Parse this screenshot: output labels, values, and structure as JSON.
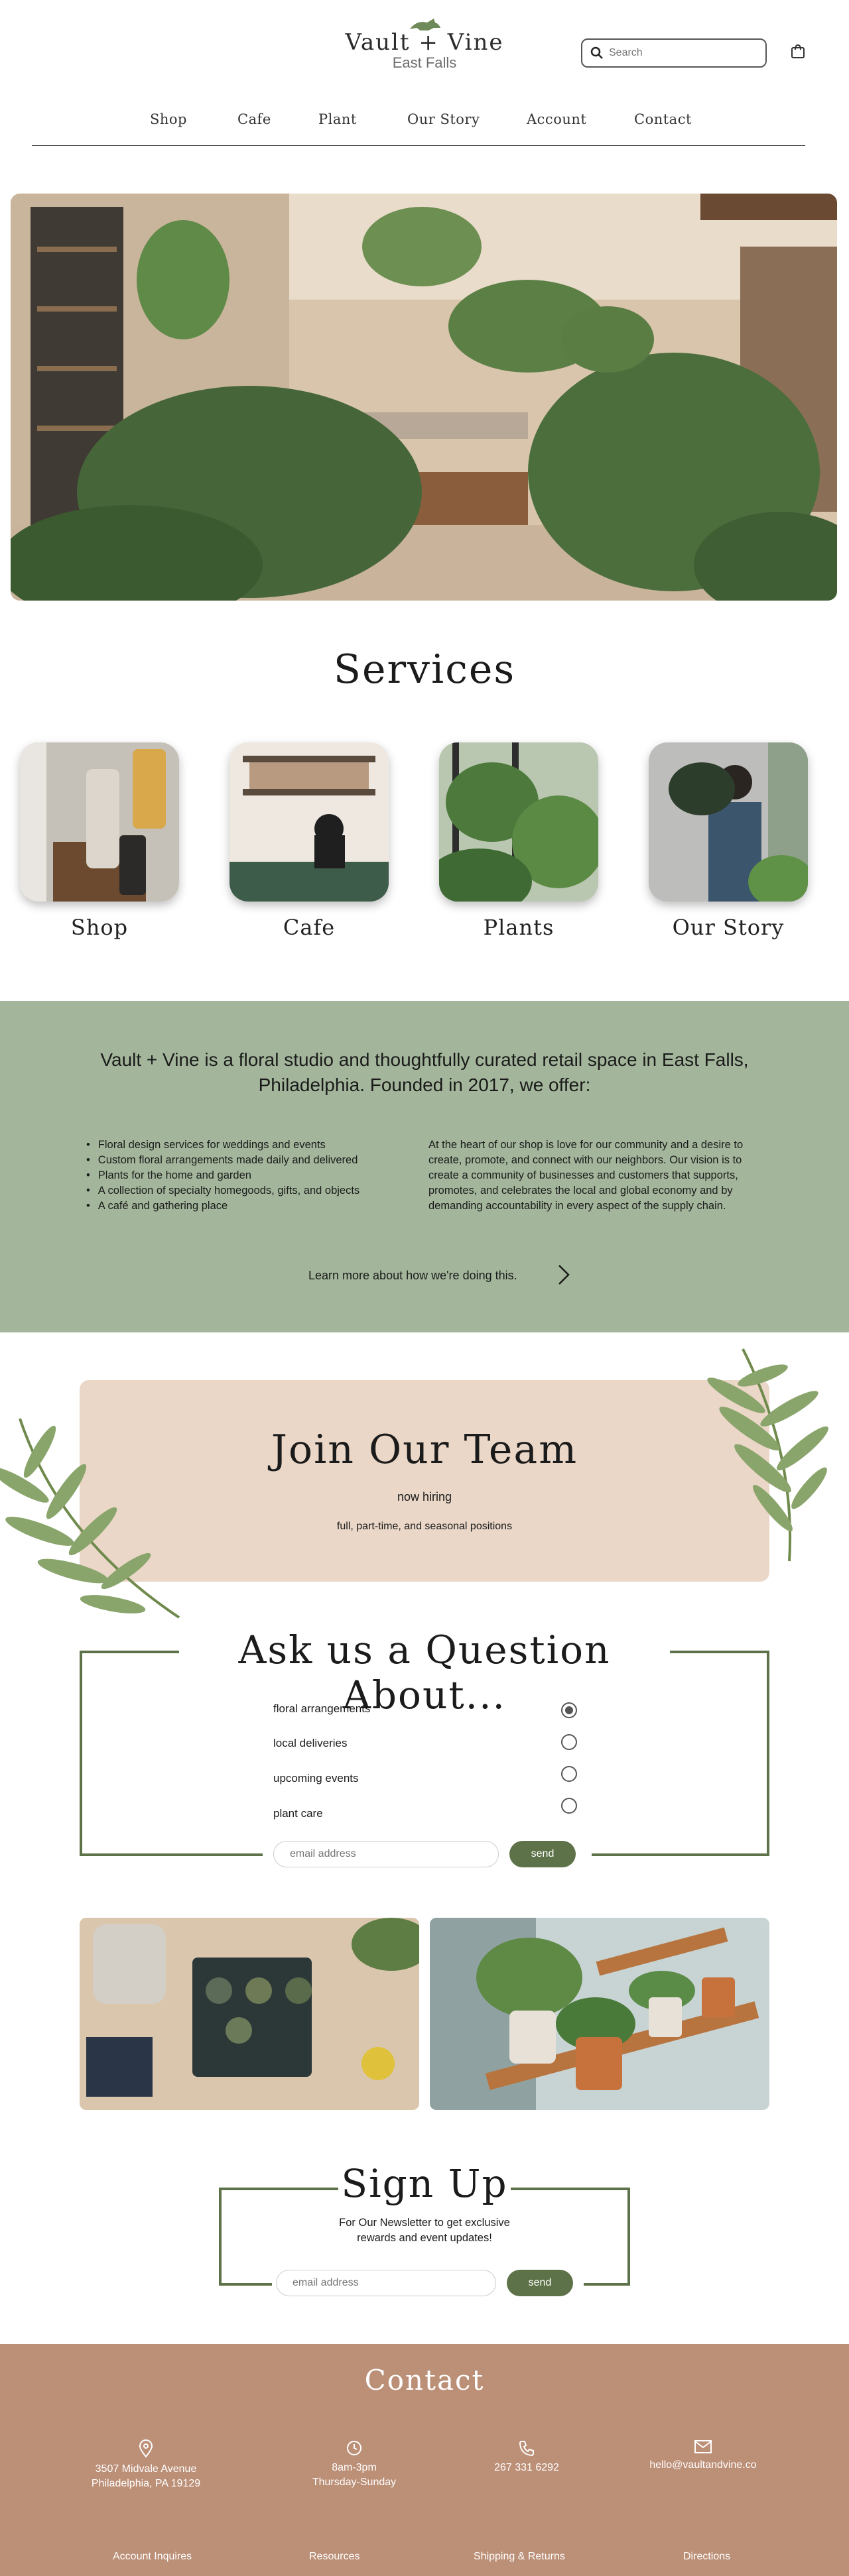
{
  "brand": {
    "name": "Vault + Vine",
    "location": "East Falls"
  },
  "header": {
    "search_placeholder": "Search"
  },
  "nav": [
    "Shop",
    "Cafe",
    "Plant",
    "Our Story",
    "Account",
    "Contact"
  ],
  "services": {
    "title": "Services",
    "items": [
      "Shop",
      "Cafe",
      "Plants",
      "Our Story"
    ]
  },
  "about": {
    "heading": "Vault + Vine is a floral studio and thoughtfully curated retail space in East Falls, Philadelphia. Founded in 2017, we offer:",
    "offers": [
      "Floral design services for weddings and events",
      "Custom floral arrangements made daily and delivered",
      "Plants for the home and garden",
      "A collection of specialty homegoods,  gifts, and objects",
      "A café and gathering place"
    ],
    "mission": "At the heart of our shop is love for our community and a desire to create, promote, and connect with our neighbors. Our vision is to create a community of businesses and customers that supports, promotes, and celebrates the local and global economy and by demanding accountability in every aspect of the supply chain.",
    "learn_more": "Learn more about how we're doing this."
  },
  "join": {
    "title": "Join Our Team",
    "subtitle": "now hiring",
    "description": "full, part-time, and seasonal positions"
  },
  "ask": {
    "title": "Ask us a Question About...",
    "options": [
      {
        "label": "floral arrangements",
        "selected": true
      },
      {
        "label": "local deliveries",
        "selected": false
      },
      {
        "label": "upcoming events",
        "selected": false
      },
      {
        "label": "plant care",
        "selected": false
      }
    ],
    "email_placeholder": "email address",
    "send_label": "send"
  },
  "signup": {
    "title": "Sign Up",
    "text": "For Our Newsletter to get exclusive rewards and event updates!",
    "email_placeholder": "email address",
    "send_label": "send"
  },
  "contact": {
    "title": "Contact",
    "address_line1": "3507 Midvale Avenue",
    "address_line2": "Philadelphia, PA 19129",
    "hours_line1": "8am-3pm",
    "hours_line2": "Thursday-Sunday",
    "phone": "267 331 6292",
    "email": "hello@vaultandvine.co"
  },
  "footer_links": [
    "Account Inquires",
    "Resources",
    "Shipping & Returns",
    "Directions"
  ],
  "colors": {
    "green": "#5d7248",
    "sage": "#a3b69b",
    "blush": "#ead7c7",
    "terracotta": "#bc8f77"
  }
}
